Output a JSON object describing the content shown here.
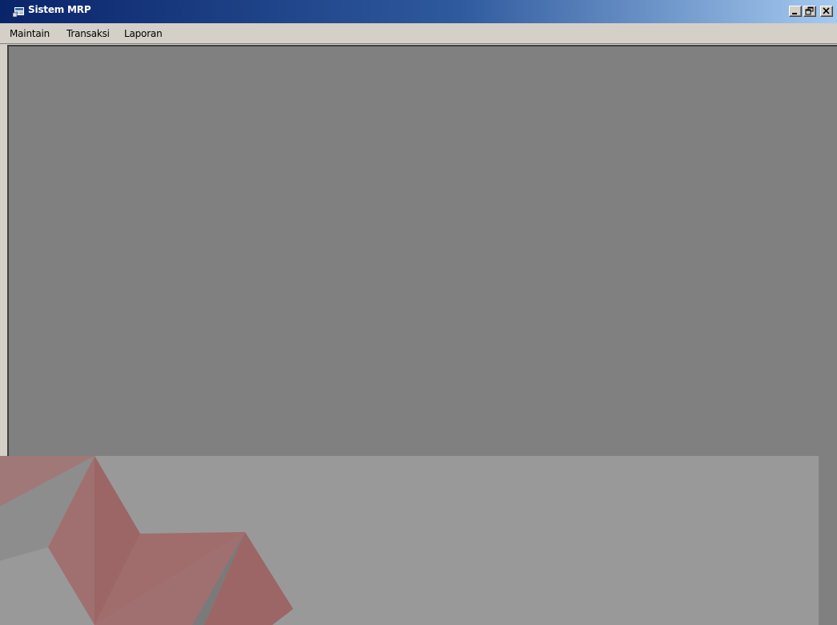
{
  "window": {
    "title": "Sistem MRP",
    "icon": "app-icon"
  },
  "caption_buttons": {
    "minimize": "minimize-icon",
    "restore": "restore-icon",
    "close": "close-icon"
  },
  "menu": {
    "items": [
      {
        "label": "Maintain"
      },
      {
        "label": "Transaksi"
      },
      {
        "label": "Laporan"
      }
    ]
  },
  "colors": {
    "titlebar_start": "#0a246a",
    "titlebar_end": "#a6caf0",
    "workspace": "#808080",
    "chrome": "#d4d0c8",
    "watermark_red": "#9c6a6a"
  }
}
